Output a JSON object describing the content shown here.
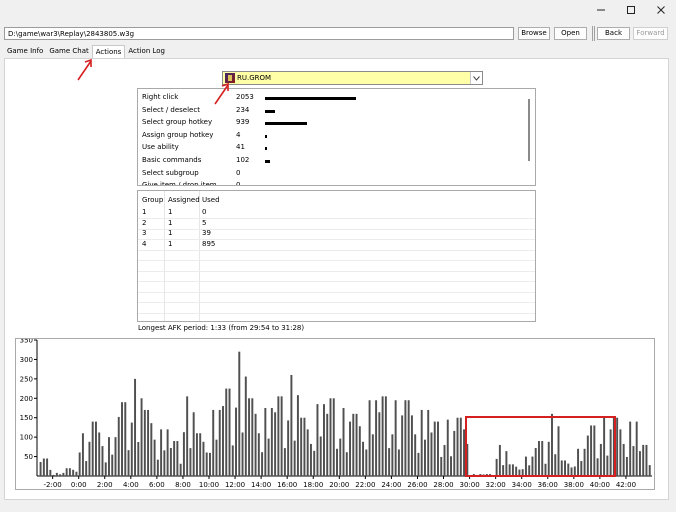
{
  "window": {
    "minimize_icon": "minimize-icon",
    "maximize_icon": "maximize-icon",
    "close_icon": "close-icon"
  },
  "path": "D:\\game\\war3\\Replay\\2843805.w3g",
  "toolbar": {
    "browse": "Browse",
    "open": "Open",
    "back": "Back",
    "forward": "Forward"
  },
  "tabs": [
    {
      "label": "Game Info",
      "active": false
    },
    {
      "label": "Game Chat",
      "active": false
    },
    {
      "label": "Actions",
      "active": true
    },
    {
      "label": "Action Log",
      "active": false
    }
  ],
  "player": {
    "name": "RU.GROM",
    "icon": "hero-portrait-icon",
    "highlight_color": "#ffffa8"
  },
  "actions": [
    {
      "label": "Right click",
      "count": 2053
    },
    {
      "label": "Select / deselect",
      "count": 234
    },
    {
      "label": "Select group hotkey",
      "count": 939
    },
    {
      "label": "Assign group hotkey",
      "count": 4
    },
    {
      "label": "Use ability",
      "count": 41
    },
    {
      "label": "Basic commands",
      "count": 102
    },
    {
      "label": "Select subgroup",
      "count": 0
    },
    {
      "label": "Give item / drop item",
      "count": 0
    }
  ],
  "groups": {
    "headers": [
      "Group",
      "Assigned",
      "Used"
    ],
    "rows": [
      [
        "1",
        "1",
        "0"
      ],
      [
        "2",
        "1",
        "5"
      ],
      [
        "3",
        "1",
        "39"
      ],
      [
        "4",
        "1",
        "895"
      ]
    ]
  },
  "afk": "Longest AFK period: 1:33 (from 29:54 to 31:28)",
  "chart_data": {
    "type": "bar",
    "y_ticks": [
      "50",
      "100",
      "150",
      "200",
      "250",
      "300",
      "350"
    ],
    "x_ticks": [
      "-2:00",
      "0:00",
      "2:00",
      "4:00",
      "6:00",
      "8:00",
      "10:00",
      "12:00",
      "14:00",
      "16:00",
      "18:00",
      "20:00",
      "22:00",
      "24:00",
      "26:00",
      "28:00",
      "30:00",
      "32:00",
      "34:00",
      "36:00",
      "38:00",
      "40:00",
      "42:00"
    ],
    "ylim": [
      0,
      350
    ],
    "xlim_minutes": [
      -3.2,
      44.0
    ],
    "grid": false,
    "bar_color": "#505050",
    "values_by_minute": [
      [
        -3,
        45
      ],
      [
        -2,
        8
      ],
      [
        -1,
        20
      ],
      [
        0,
        110
      ],
      [
        1,
        140
      ],
      [
        2,
        100
      ],
      [
        3,
        190
      ],
      [
        4,
        250
      ],
      [
        5,
        170
      ],
      [
        6,
        120
      ],
      [
        7,
        90
      ],
      [
        8,
        205
      ],
      [
        9,
        110
      ],
      [
        10,
        170
      ],
      [
        11,
        225
      ],
      [
        12,
        320
      ],
      [
        13,
        200
      ],
      [
        14,
        175
      ],
      [
        15,
        205
      ],
      [
        16,
        260
      ],
      [
        17,
        150
      ],
      [
        18,
        185
      ],
      [
        19,
        200
      ],
      [
        20,
        175
      ],
      [
        21,
        160
      ],
      [
        22,
        195
      ],
      [
        23,
        205
      ],
      [
        24,
        195
      ],
      [
        25,
        195
      ],
      [
        26,
        170
      ],
      [
        27,
        140
      ],
      [
        28,
        145
      ],
      [
        29,
        150
      ],
      [
        30,
        5
      ],
      [
        31,
        5
      ],
      [
        32,
        80
      ],
      [
        33,
        30
      ],
      [
        34,
        50
      ],
      [
        35,
        90
      ],
      [
        36,
        160
      ],
      [
        37,
        40
      ],
      [
        38,
        70
      ],
      [
        39,
        130
      ],
      [
        40,
        150
      ],
      [
        41,
        150
      ],
      [
        42,
        140
      ],
      [
        43,
        80
      ]
    ]
  },
  "annotation_color": "#d42020"
}
